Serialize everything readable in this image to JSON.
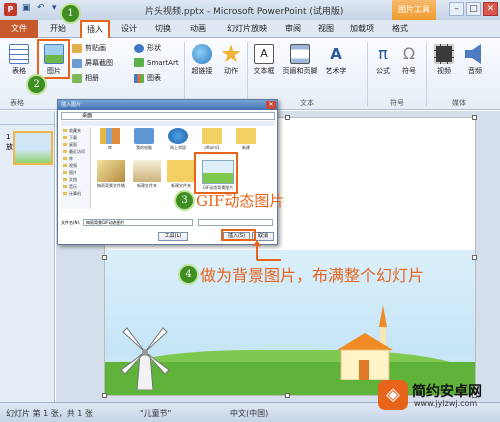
{
  "window": {
    "title": "片头视频.pptx - Microsoft PowerPoint (试用版)",
    "context_tools": "图片工具",
    "minimize": "–",
    "maximize": "□",
    "close": "✕"
  },
  "tabs": {
    "file": "文件",
    "home": "开始",
    "insert": "插入",
    "design": "设计",
    "transitions": "切换",
    "animations": "动画",
    "slideshow": "幻灯片放映",
    "review": "审阅",
    "view": "视图",
    "addins": "加载项",
    "format": "格式"
  },
  "ribbon": {
    "table": "表格",
    "picture": "图片",
    "clipart": "剪贴画",
    "screenshot": "屏幕截图",
    "album": "相册",
    "shapes": "形状",
    "smartart": "SmartArt",
    "chart": "图表",
    "hyperlink": "超链接",
    "action": "动作",
    "textbox": "文本框",
    "header_footer": "页眉和页脚",
    "wordart": "艺术字",
    "equation": "公式",
    "symbol": "符号",
    "video": "视频",
    "audio": "音频",
    "group_tables": "表格",
    "group_text": "文本",
    "group_symbols": "符号",
    "group_media": "媒体"
  },
  "slides_pane": {
    "slide_num": "1",
    "label": "放"
  },
  "dialog": {
    "title": "插入图片",
    "address": "桌面",
    "nav": [
      "收藏夹",
      "下载",
      "桌面",
      "最近访问",
      "库",
      "视频",
      "图片",
      "文档",
      "音乐",
      "计算机"
    ],
    "files": [
      "库",
      "我的电脑",
      "网上邻居",
      "oftaim1",
      "新建",
      "梅雨背景文件桶",
      "新建文件夹",
      "新建文件夹",
      "GIF动态背景图片"
    ],
    "filename_label": "文件名(N):",
    "filename_value": "梅雨背景GIF动态图片",
    "tools_label": "工具(L)",
    "insert_button": "插入(S)",
    "cancel_button": "取消"
  },
  "callouts": {
    "c1": "1",
    "c2": "2",
    "c3": "3",
    "c3_text": "GIF动态图片",
    "c4": "4",
    "c4_text": "做为背景图片，布满整个幻灯片"
  },
  "status": {
    "slide": "幻灯片 第 1 张，共 1 张",
    "theme": "\"儿童节\"",
    "language": "中文(中国)"
  },
  "watermark": {
    "name": "简约安卓网",
    "url": "www.jylzwj.com",
    "logo": "◈"
  },
  "colors": {
    "accent": "#e8641b",
    "callout_green": "#3f8e22",
    "file_tab": "#c65a2c"
  }
}
